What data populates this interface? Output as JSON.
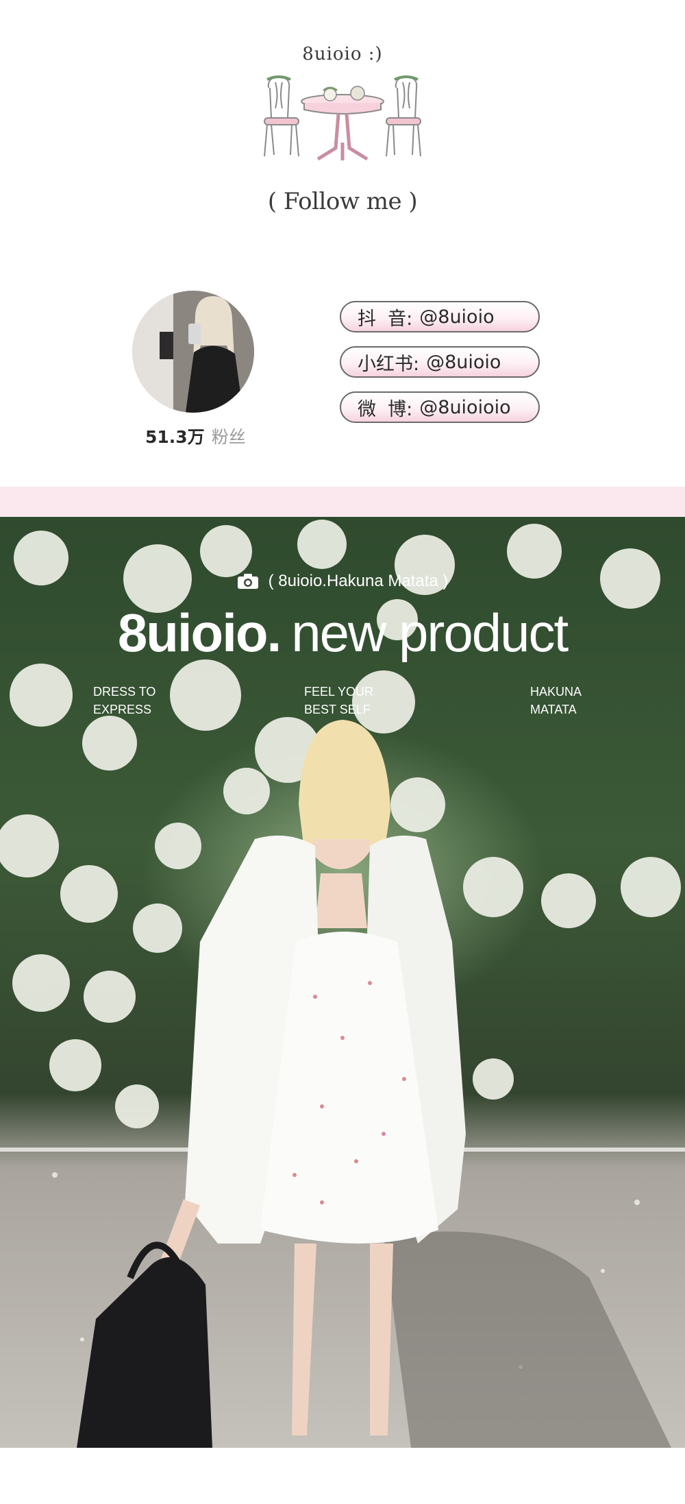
{
  "header": {
    "brand_line": "8uioio   :)",
    "follow_line": "( Follow me )"
  },
  "profile": {
    "followers_count": "51.3万",
    "followers_label": "粉丝",
    "socials": [
      {
        "platform": "抖  音:",
        "handle": "@8uioio"
      },
      {
        "platform": "小红书:",
        "handle": "@8uioio"
      },
      {
        "platform": "微  博:",
        "handle": "@8uioioio"
      }
    ]
  },
  "banner": {
    "camera_caption": "( 8uioio.Hakuna Matata )",
    "headline_bold": "8uioio.",
    "headline_light": "new product",
    "taglines": [
      {
        "line1": "DRESS TO",
        "line2": "EXPRESS"
      },
      {
        "line1": "FEEL YOUR",
        "line2": "BEST SELF"
      },
      {
        "line1": "HAKUNA",
        "line2": "MATATA"
      }
    ]
  },
  "colors": {
    "pink_band": "#fbe8ef",
    "pill_pink": "#f6d3de",
    "text_dark": "#2a2a2a",
    "foliage": "#2f4a2e",
    "pavement": "#c5c1bb"
  }
}
